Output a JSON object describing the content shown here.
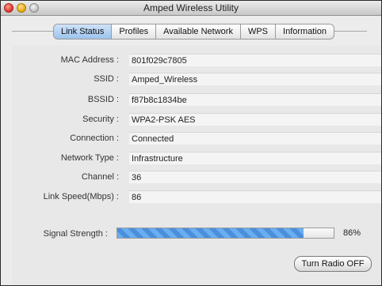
{
  "window": {
    "title": "Amped Wireless Utility"
  },
  "tabs": [
    {
      "label": "Link Status",
      "active": true
    },
    {
      "label": "Profiles",
      "active": false
    },
    {
      "label": "Available Network",
      "active": false
    },
    {
      "label": "WPS",
      "active": false
    },
    {
      "label": "Information",
      "active": false
    }
  ],
  "fields": {
    "mac": {
      "label": "MAC Address :",
      "value": "801f029c7805"
    },
    "ssid": {
      "label": "SSID :",
      "value": "Amped_Wireless"
    },
    "bssid": {
      "label": "BSSID :",
      "value": "f87b8c1834be"
    },
    "security": {
      "label": "Security :",
      "value": "WPA2-PSK AES"
    },
    "connection": {
      "label": "Connection :",
      "value": "Connected"
    },
    "network_type": {
      "label": "Network Type :",
      "value": "Infrastructure"
    },
    "channel": {
      "label": "Channel :",
      "value": "36"
    },
    "link_speed": {
      "label": "Link Speed(Mbps) :",
      "value": "86"
    }
  },
  "signal": {
    "label": "Signal Strength :",
    "percent_text": "86%",
    "percent": 86
  },
  "buttons": {
    "radio_label": "Turn Radio OFF"
  },
  "colors": {
    "accent": "#9cc3ee",
    "progress": "#4a8fdc"
  }
}
